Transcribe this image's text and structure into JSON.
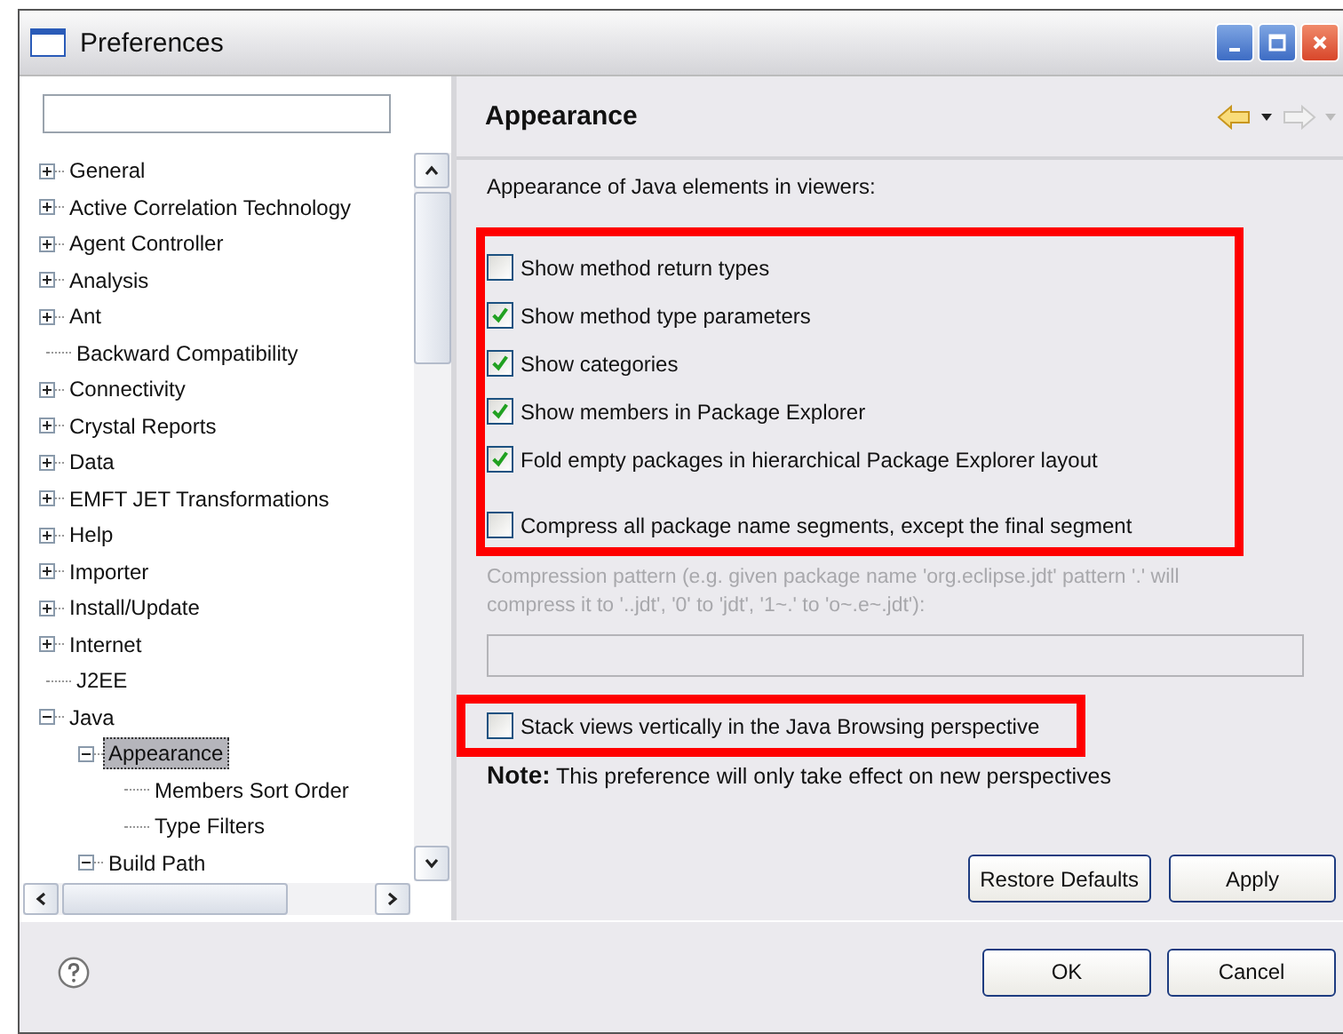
{
  "window": {
    "title": "Preferences"
  },
  "tree": {
    "items": [
      {
        "label": "General",
        "kind": "folder",
        "expanded": false,
        "selected": false
      },
      {
        "label": "Active Correlation Technology",
        "kind": "folder",
        "expanded": false,
        "selected": false
      },
      {
        "label": "Agent Controller",
        "kind": "folder",
        "expanded": false,
        "selected": false
      },
      {
        "label": "Analysis",
        "kind": "folder",
        "expanded": false,
        "selected": false
      },
      {
        "label": "Ant",
        "kind": "folder",
        "expanded": false,
        "selected": false
      },
      {
        "label": "Backward Compatibility",
        "kind": "leaf",
        "selected": false
      },
      {
        "label": "Connectivity",
        "kind": "folder",
        "expanded": false,
        "selected": false
      },
      {
        "label": "Crystal Reports",
        "kind": "folder",
        "expanded": false,
        "selected": false
      },
      {
        "label": "Data",
        "kind": "folder",
        "expanded": false,
        "selected": false
      },
      {
        "label": "EMFT JET Transformations",
        "kind": "folder",
        "expanded": false,
        "selected": false
      },
      {
        "label": "Help",
        "kind": "folder",
        "expanded": false,
        "selected": false
      },
      {
        "label": "Importer",
        "kind": "folder",
        "expanded": false,
        "selected": false
      },
      {
        "label": "Install/Update",
        "kind": "folder",
        "expanded": false,
        "selected": false
      },
      {
        "label": "Internet",
        "kind": "folder",
        "expanded": false,
        "selected": false
      },
      {
        "label": "J2EE",
        "kind": "leaf",
        "selected": false
      },
      {
        "label": "Java",
        "kind": "folder",
        "expanded": true,
        "selected": false,
        "children": [
          {
            "label": "Appearance",
            "kind": "folder",
            "expanded": true,
            "selected": true,
            "children": [
              {
                "label": "Members Sort Order",
                "kind": "leaf",
                "selected": false
              },
              {
                "label": "Type Filters",
                "kind": "leaf",
                "selected": false
              }
            ]
          },
          {
            "label": "Build Path",
            "kind": "folder",
            "expanded": true,
            "selected": false
          }
        ]
      }
    ]
  },
  "page": {
    "title": "Appearance",
    "intro": "Appearance of Java elements in viewers:",
    "options_block": {
      "highlighted": true,
      "groups": [
        {
          "options": [
            {
              "label": "Show method return types",
              "checked": false
            },
            {
              "label": "Show method type parameters",
              "checked": true
            },
            {
              "label": "Show categories",
              "checked": true
            },
            {
              "label": "Show members in Package Explorer",
              "checked": true
            },
            {
              "label": "Fold empty packages in hierarchical Package Explorer layout",
              "checked": true
            }
          ]
        },
        {
          "options": [
            {
              "label": "Compress all package name segments, except the final segment",
              "checked": false
            }
          ]
        }
      ]
    },
    "compression": {
      "lines": [
        "Compression pattern (e.g. given package name 'org.eclipse.jdt' pattern '.' will",
        "compress it to '..jdt',  '0' to 'jdt', '1~.' to 'o~.e~.jdt'):"
      ],
      "disabled": true
    },
    "stack_group": {
      "highlighted": true,
      "options": [
        {
          "label": "Stack views vertically in the Java Browsing perspective",
          "checked": false
        }
      ]
    },
    "note": "**Note:** This preference will only take effect on new perspectives",
    "buttons": [
      "Restore Defaults",
      "Apply"
    ]
  },
  "dialog_buttons": [
    "OK",
    "Cancel"
  ]
}
